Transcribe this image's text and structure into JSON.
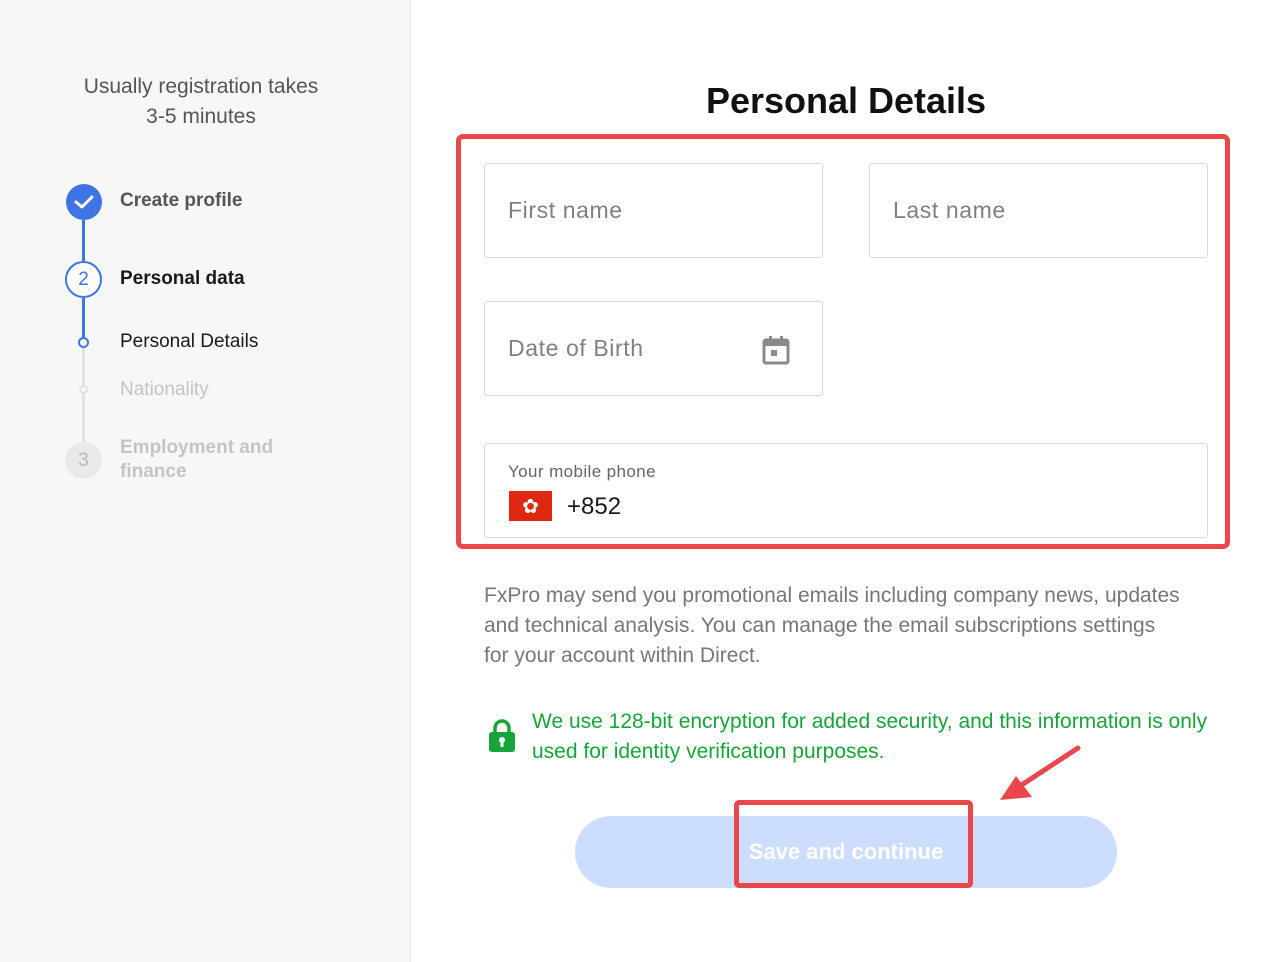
{
  "sidebar": {
    "note_line1": "Usually registration takes",
    "note_line2": "3-5 minutes",
    "steps": [
      {
        "number": "",
        "label": "Create profile",
        "state": "done"
      },
      {
        "number": "2",
        "label": "Personal data",
        "state": "current",
        "substeps": [
          {
            "label": "Personal Details",
            "state": "active"
          },
          {
            "label": "Nationality",
            "state": "pending"
          }
        ]
      },
      {
        "number": "3",
        "label": "Employment and finance",
        "state": "pending"
      }
    ]
  },
  "form": {
    "title": "Personal Details",
    "first_name_placeholder": "First name",
    "last_name_placeholder": "Last name",
    "dob_placeholder": "Date of Birth",
    "phone_label": "Your mobile phone",
    "phone_country_code": "+852",
    "phone_flag_symbol": "✿",
    "promo_text": "FxPro may send you promotional emails including company news, updates and technical analysis. You can manage the email subscriptions settings for your account within Direct.",
    "security_text": "We use 128-bit encryption for added security, and this information is only used for identity verification purposes.",
    "submit_label": "Save and continue"
  },
  "colors": {
    "accent": "#3f74e5",
    "annotation": "#e8474c",
    "security": "#17a43b",
    "button_disabled": "#cdddfd",
    "flag": "#de2910"
  },
  "icons": {
    "done_marker": "check-icon",
    "dob": "calendar-icon",
    "flag": "hong-kong-flag-icon",
    "security": "lock-icon",
    "annotation": "arrow-icon"
  }
}
